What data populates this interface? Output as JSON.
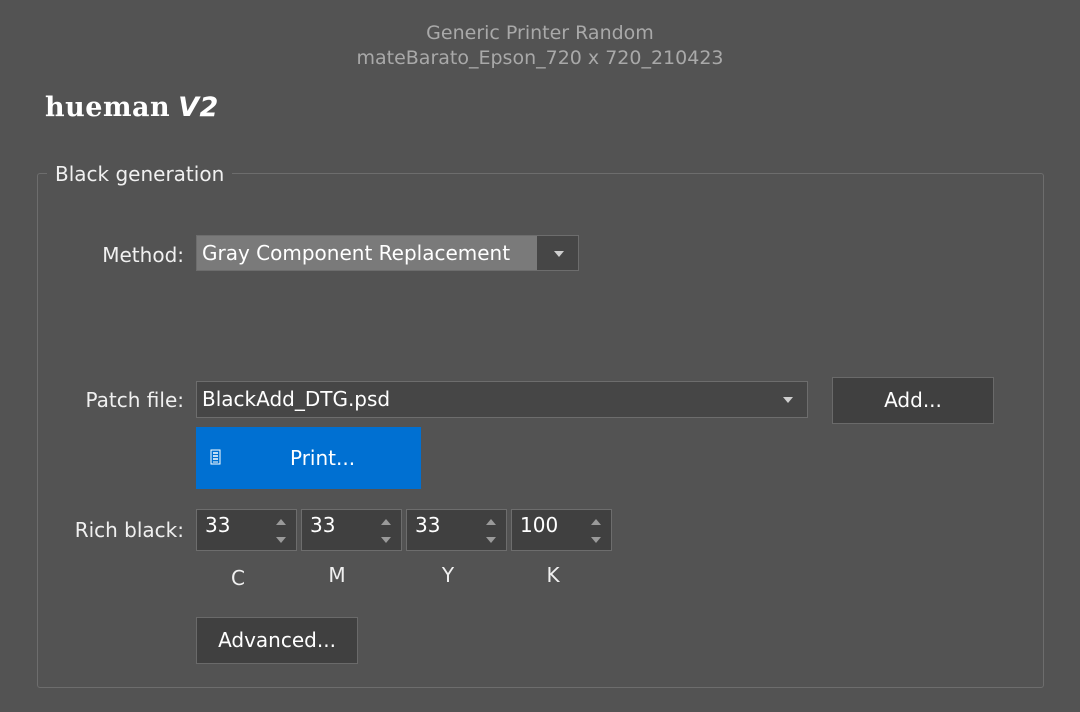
{
  "header": {
    "printer": "Generic Printer Random",
    "profile": "mateBarato_Epson_720 x 720_210423"
  },
  "logo": {
    "text": "hueman",
    "version": "V2"
  },
  "black_generation": {
    "title": "Black generation",
    "method": {
      "label": "Method:",
      "value": "Gray Component Replacement"
    },
    "patch_file": {
      "label": "Patch file:",
      "value": "BlackAdd_DTG.psd",
      "add_label": "Add..."
    },
    "print_label": "Print...",
    "rich_black": {
      "label": "Rich black:",
      "c": {
        "value": "33",
        "label": "C"
      },
      "m": {
        "value": "33",
        "label": "M"
      },
      "y": {
        "value": "33",
        "label": "Y"
      },
      "k": {
        "value": "100",
        "label": "K"
      }
    },
    "advanced_label": "Advanced..."
  },
  "colors": {
    "background": "#535353",
    "accent": "#0070d2"
  }
}
